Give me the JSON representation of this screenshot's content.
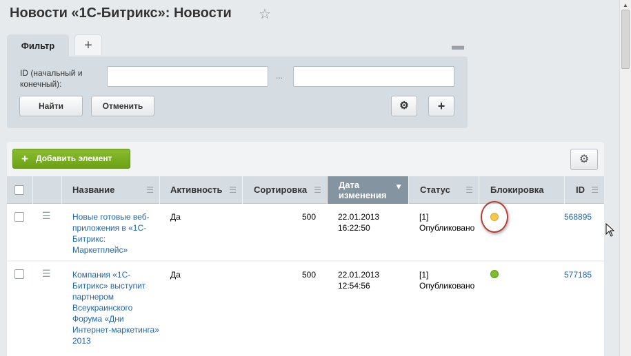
{
  "page": {
    "title": "Новости «1С-Битрикс»: Новости",
    "star_icon": "star-icon"
  },
  "filter": {
    "tab_label": "Фильтр",
    "add_tab_icon": "plus-icon",
    "minimize_icon": "minus-icon",
    "id_label": "ID (начальный и конечный):",
    "range_from": "",
    "range_to": "",
    "separator": "...",
    "find_label": "Найти",
    "cancel_label": "Отменить",
    "settings_icon": "gear-icon",
    "add_field_icon": "plus-icon"
  },
  "list": {
    "add_label": "Добавить элемент",
    "settings_icon": "gear-icon",
    "columns": {
      "name": "Название",
      "active": "Активность",
      "sort": "Сортировка",
      "date": "Дата изменения",
      "status": "Статус",
      "lock": "Блокировка",
      "id": "ID"
    },
    "rows": [
      {
        "name": "Новые готовые веб-приложения в «1С-Битрикс: Маркетплейс»",
        "active": "Да",
        "sort": "500",
        "date": "22.01.2013",
        "time": "16:22:50",
        "status_code": "[1]",
        "status_text": "Опубликовано",
        "lock_color": "#f2c94c",
        "id": "568895"
      },
      {
        "name": "Компания «1С-Битрикс» выступит партнером Всеукраинского Форума «Дни Интернет-маркетинга» 2013",
        "active": "Да",
        "sort": "500",
        "date": "22.01.2013",
        "time": "12:54:56",
        "status_code": "[1]",
        "status_text": "Опубликовано",
        "lock_color": "#7cbf2b",
        "id": "577185"
      }
    ]
  },
  "colors": {
    "accent_green": "#7ab325",
    "link_blue": "#2067b0",
    "sorted_header": "#8594a1",
    "highlight_ring": "#b53d35"
  }
}
